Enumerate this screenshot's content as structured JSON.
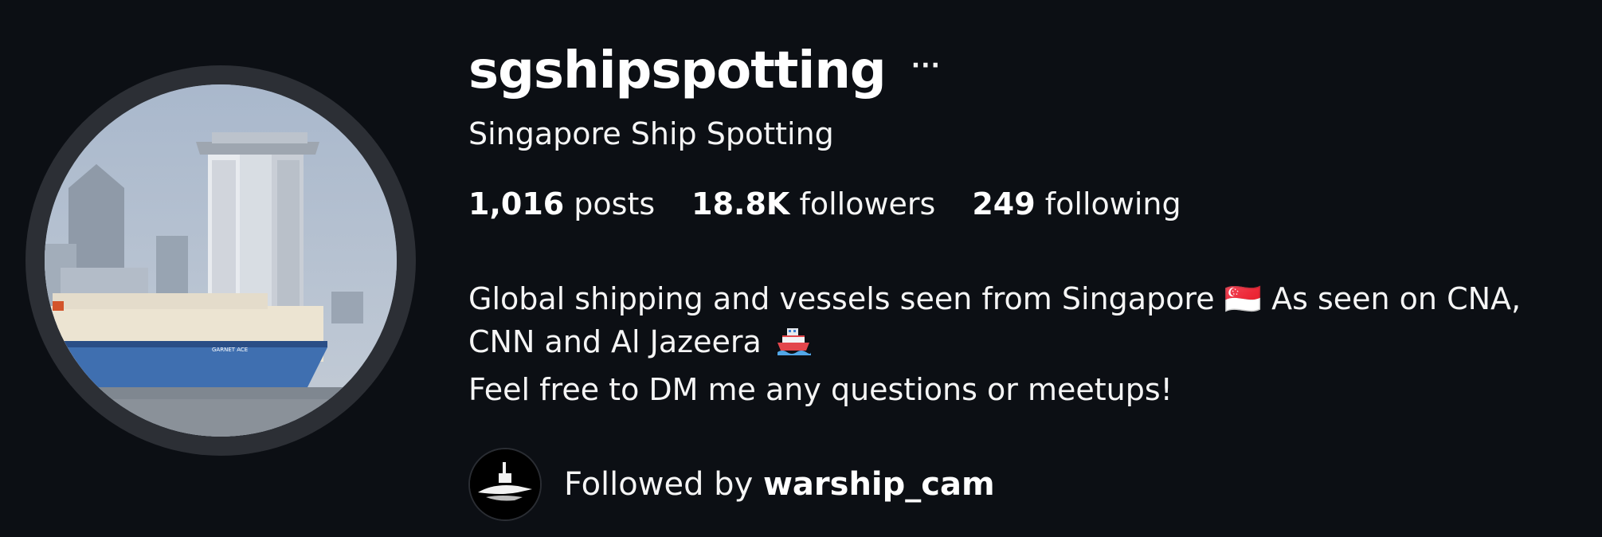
{
  "profile": {
    "username": "sgshipspotting",
    "more_label": "···",
    "full_name": "Singapore Ship Spotting",
    "stats": {
      "posts_count": "1,016",
      "posts_label": "posts",
      "followers_count": "18.8K",
      "followers_label": "followers",
      "following_count": "249",
      "following_label": "following"
    },
    "bio": {
      "line1": "Global shipping and vessels seen from Singapore 🇸🇬 As seen on CNA,",
      "line2": "CNN and Al Jazeera",
      "line3": "Feel free to DM me any questions or meetups!"
    },
    "followed_by": {
      "prefix": "Followed by",
      "username": "warship_cam"
    }
  },
  "colors": {
    "background": "#0c0f14",
    "text": "#f5f5f5",
    "avatar_ring": "#2c2f35"
  },
  "icons": {
    "avatar": "ship-photo-avatar",
    "more": "more-options-icon",
    "ship_emoji": "ship-emoji-icon",
    "mini_avatar": "submarine-avatar"
  }
}
